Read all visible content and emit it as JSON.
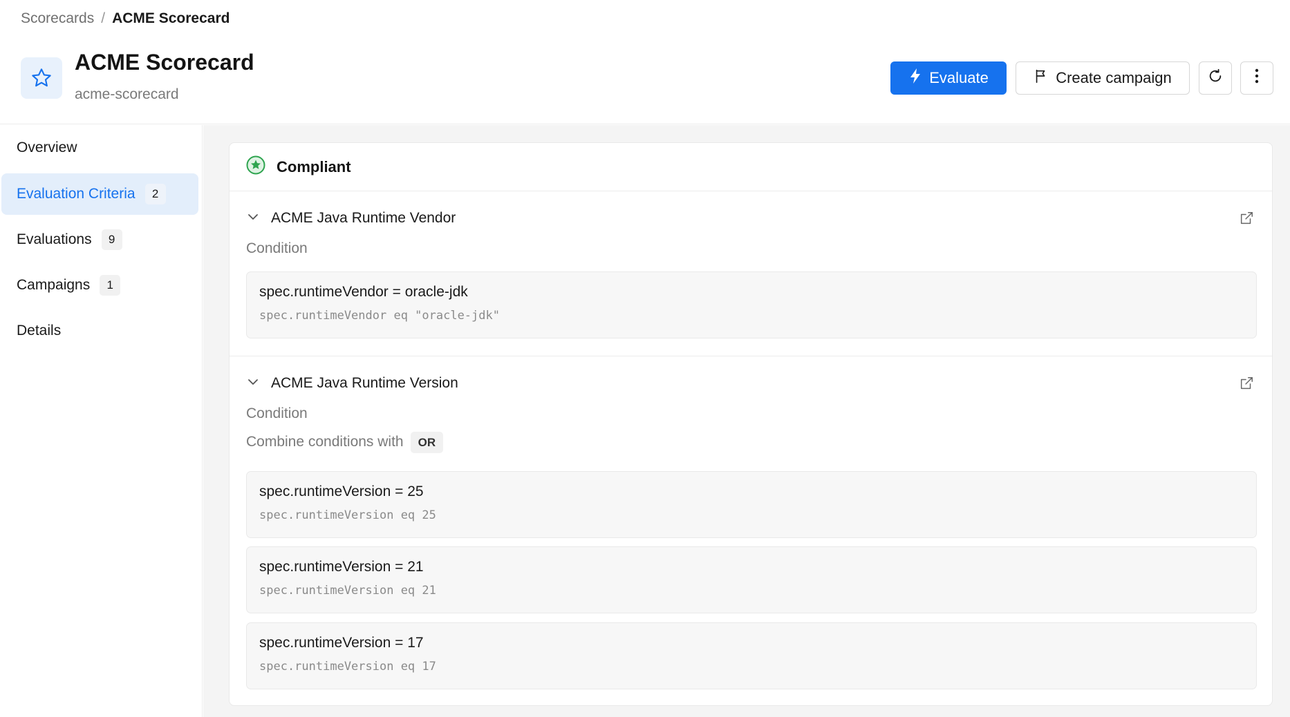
{
  "breadcrumb": {
    "parent": "Scorecards",
    "separator": "/",
    "current": "ACME Scorecard"
  },
  "header": {
    "title": "ACME Scorecard",
    "subtitle": "acme-scorecard",
    "icon": "star-icon",
    "actions": {
      "evaluate_label": "Evaluate",
      "create_campaign_label": "Create campaign",
      "refresh_icon": "refresh-icon",
      "more_icon": "more-vertical-icon"
    }
  },
  "sidebar": {
    "items": [
      {
        "label": "Overview",
        "count": ""
      },
      {
        "label": "Evaluation Criteria",
        "count": "2",
        "active": true
      },
      {
        "label": "Evaluations",
        "count": "9"
      },
      {
        "label": "Campaigns",
        "count": "1"
      },
      {
        "label": "Details",
        "count": ""
      }
    ]
  },
  "content": {
    "status": {
      "label": "Compliant",
      "color": "#2ea44f"
    },
    "criteria": [
      {
        "name": "ACME Java Runtime Vendor",
        "condition_label": "Condition",
        "conditions": [
          {
            "display": "spec.runtimeVendor = oracle-jdk",
            "expression": "spec.runtimeVendor eq \"oracle-jdk\""
          }
        ]
      },
      {
        "name": "ACME Java Runtime Version",
        "condition_label": "Condition",
        "combine_label": "Combine conditions with",
        "combine_operator": "OR",
        "conditions": [
          {
            "display": "spec.runtimeVersion = 25",
            "expression": "spec.runtimeVersion eq 25"
          },
          {
            "display": "spec.runtimeVersion = 21",
            "expression": "spec.runtimeVersion eq 21"
          },
          {
            "display": "spec.runtimeVersion = 17",
            "expression": "spec.runtimeVersion eq 17"
          }
        ]
      }
    ]
  },
  "colors": {
    "accent": "#1672ee",
    "active_nav_bg": "#e3eefb",
    "compliant": "#2ea44f"
  }
}
